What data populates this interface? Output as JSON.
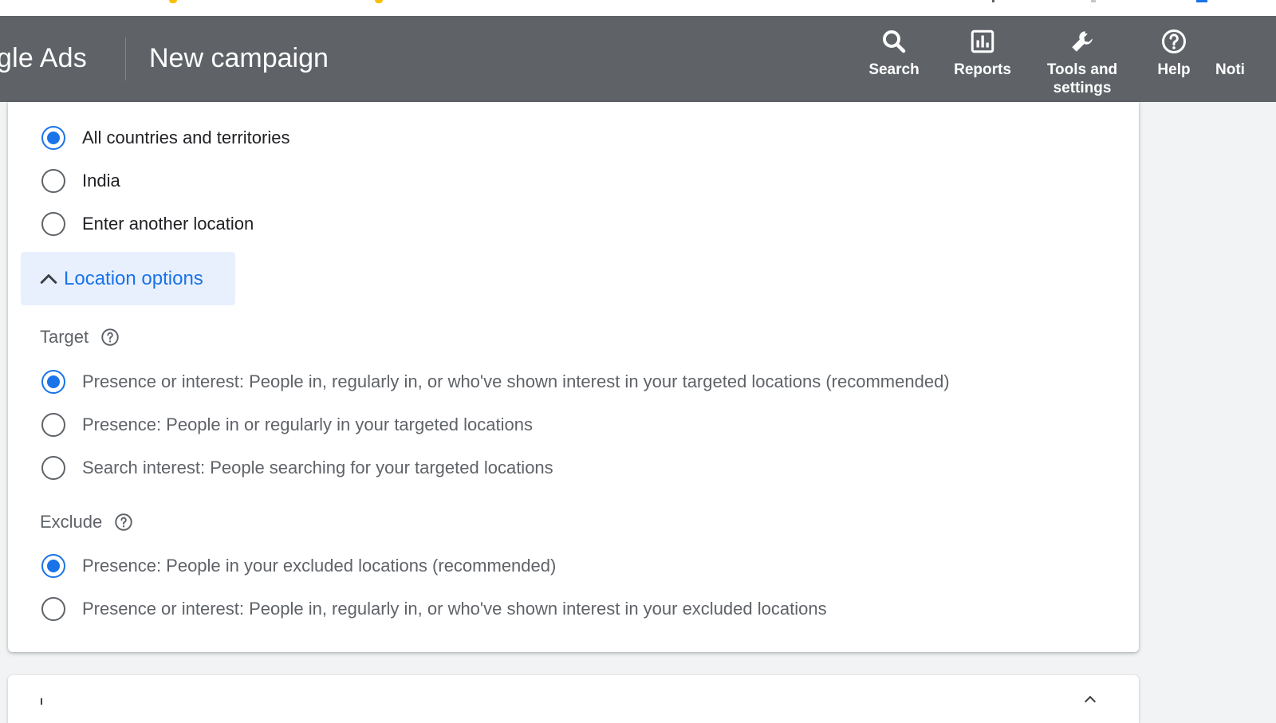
{
  "header": {
    "brand": "gle Ads",
    "page_title": "New campaign",
    "nav": {
      "search": "Search",
      "reports": "Reports",
      "tools_line1": "Tools and",
      "tools_line2": "settings",
      "help": "Help",
      "notifications": "Noti"
    }
  },
  "locations": {
    "options": [
      {
        "label": "All countries and territories",
        "selected": true
      },
      {
        "label": "India",
        "selected": false
      },
      {
        "label": "Enter another location",
        "selected": false
      }
    ],
    "location_options_label": "Location options"
  },
  "target": {
    "label": "Target",
    "options": [
      {
        "label": "Presence or interest: People in, regularly in, or who've shown interest in your targeted locations (recommended)",
        "selected": true
      },
      {
        "label": "Presence: People in or regularly in your targeted locations",
        "selected": false
      },
      {
        "label": "Search interest: People searching for your targeted locations",
        "selected": false
      }
    ]
  },
  "exclude": {
    "label": "Exclude",
    "options": [
      {
        "label": "Presence: People in your excluded locations (recommended)",
        "selected": true
      },
      {
        "label": "Presence or interest: People in, regularly in, or who've shown interest in your excluded locations",
        "selected": false
      }
    ]
  },
  "colors": {
    "header_bg": "#5f6368",
    "accent": "#1a73e8",
    "expand_bg": "#e8f0fe"
  }
}
